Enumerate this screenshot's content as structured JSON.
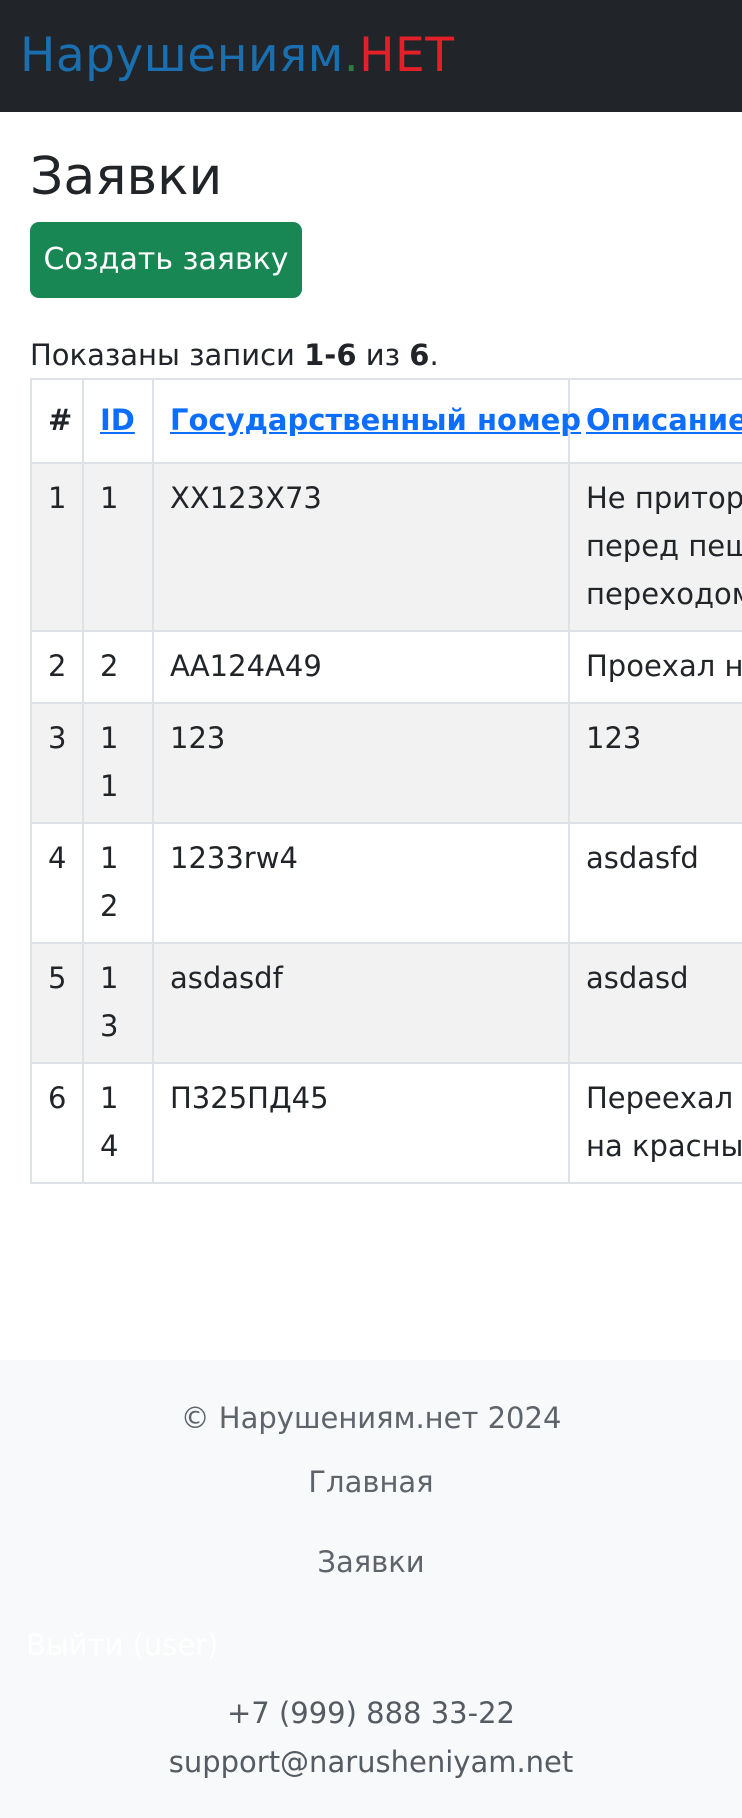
{
  "header": {
    "brand_part1": "Нарушениям",
    "brand_dot": ".",
    "brand_part2": "НЕТ",
    "colors": {
      "background": "#212529",
      "brand_blue": "#1a6fb0",
      "brand_red": "#e3202a"
    }
  },
  "main": {
    "title": "Заявки",
    "create_button": "Создать заявку",
    "summary": {
      "prefix": "Показаны записи ",
      "range": "1-6",
      "middle": " из ",
      "total": "6",
      "suffix": "."
    },
    "table": {
      "headers": [
        "#",
        "ID",
        "Государственный номер",
        "Описание"
      ],
      "rows": [
        {
          "num": "1",
          "id": "1",
          "plate": "XX123X73",
          "description": "Не притормозил перед пешеходным переходом"
        },
        {
          "num": "2",
          "id": "2",
          "plate": "АА124А49",
          "description": "Проехал на красный"
        },
        {
          "num": "3",
          "id": "11",
          "plate": "123",
          "description": "123"
        },
        {
          "num": "4",
          "id": "12",
          "plate": "1233rw4",
          "description": "asdasfd"
        },
        {
          "num": "5",
          "id": "13",
          "plate": "asdasdf",
          "description": "asdasd"
        },
        {
          "num": "6",
          "id": "14",
          "plate": "П325ПД45",
          "description": "Переехал бабушку на красный"
        }
      ]
    },
    "colors": {
      "button": "#198754",
      "link": "#0d6efd",
      "stripe": "#f2f2f2"
    }
  },
  "footer": {
    "copyright": "© Нарушениям.нет 2024",
    "nav_home": "Главная",
    "nav_requests": "Заявки",
    "logout": "Выйти (user)",
    "phone": "+7 (999) 888 33-22",
    "email": "support@narusheniyam.net"
  }
}
